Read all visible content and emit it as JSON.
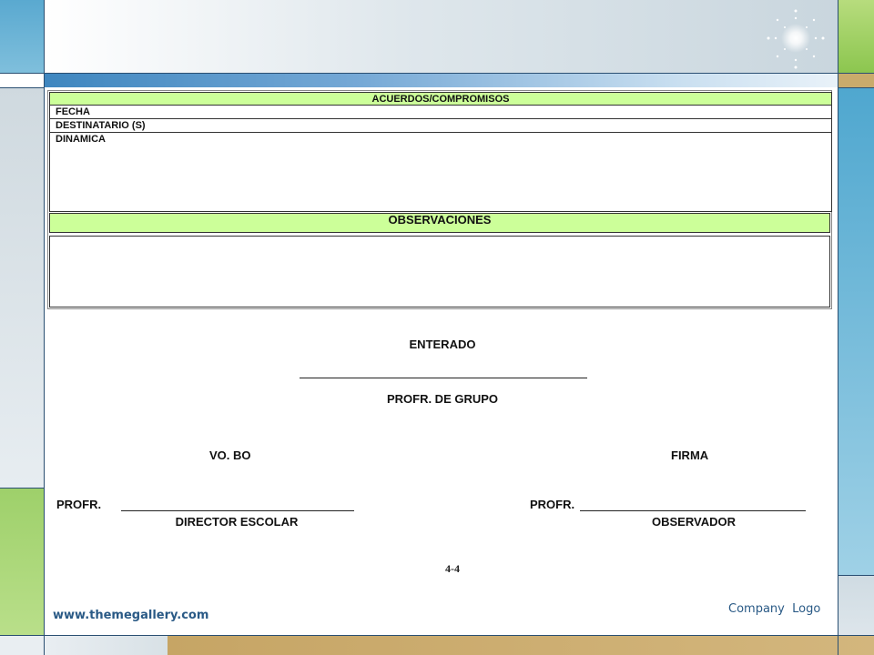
{
  "form": {
    "agreements_header": "ACUERDOS/COMPROMISOS",
    "date_label": "FECHA",
    "recipient_label": "DESTINATARIO (S)",
    "dynamics_label": "DINAMICA",
    "observations_header": "OBSERVACIONES"
  },
  "signatures": {
    "acknowledged": "ENTERADO",
    "group_teacher": "PROFR. DE GRUPO",
    "approval": "VO. BO",
    "signature": "FIRMA",
    "profr_left": "PROFR.",
    "school_director": "DIRECTOR ESCOLAR",
    "profr_right": "PROFR.",
    "observer": "OBSERVADOR"
  },
  "page_number": "4-4",
  "footer": {
    "url": "www.themegallery.com",
    "company_logo": "Company  Logo"
  },
  "colors": {
    "header_fill": "#ccff99",
    "footer_text": "#2a5a86"
  },
  "icons": [
    "sparkle-icon"
  ]
}
